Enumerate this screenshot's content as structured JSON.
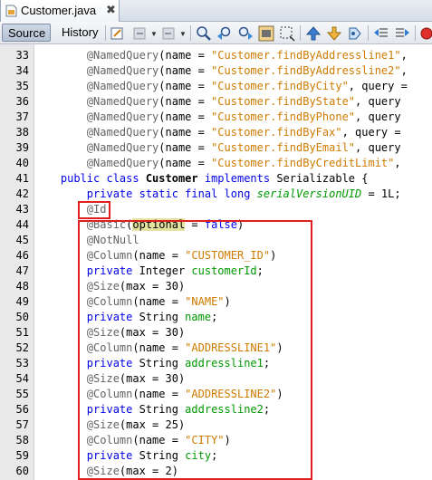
{
  "editor_tab": {
    "title": "Customer.java",
    "close": "✖"
  },
  "toolbar": {
    "source_label": "Source",
    "history_label": "History",
    "icons": [
      "last-edit-icon",
      "back-icon",
      "forward-icon",
      "find-selection-icon",
      "find-previous-icon",
      "find-next-icon",
      "toggle-highlight-icon",
      "toggle-rectangular-selection-icon",
      "previous-bookmark-icon",
      "next-bookmark-icon",
      "toggle-bookmark-icon",
      "shift-left-icon",
      "shift-right-icon",
      "start-macro-icon"
    ]
  },
  "colors": {
    "annotation": "#646464",
    "string": "#ce7b00",
    "keyword": "#0000e6",
    "field": "#009900",
    "highlight_box": "#e0201e"
  },
  "code": {
    "lines": [
      {
        "num": "33",
        "tokens": [
          [
            "ann",
            "        @NamedQuery"
          ],
          [
            "",
            "(name = "
          ],
          [
            "str",
            "\"Customer.findByAddressline1\""
          ],
          [
            "",
            ","
          ]
        ]
      },
      {
        "num": "34",
        "tokens": [
          [
            "ann",
            "        @NamedQuery"
          ],
          [
            "",
            "(name = "
          ],
          [
            "str",
            "\"Customer.findByAddressline2\""
          ],
          [
            "",
            ","
          ]
        ]
      },
      {
        "num": "35",
        "tokens": [
          [
            "ann",
            "        @NamedQuery"
          ],
          [
            "",
            "(name = "
          ],
          [
            "str",
            "\"Customer.findByCity\""
          ],
          [
            "",
            ", query ="
          ]
        ]
      },
      {
        "num": "36",
        "tokens": [
          [
            "ann",
            "        @NamedQuery"
          ],
          [
            "",
            "(name = "
          ],
          [
            "str",
            "\"Customer.findByState\""
          ],
          [
            "",
            ", query"
          ]
        ]
      },
      {
        "num": "37",
        "tokens": [
          [
            "ann",
            "        @NamedQuery"
          ],
          [
            "",
            "(name = "
          ],
          [
            "str",
            "\"Customer.findByPhone\""
          ],
          [
            "",
            ", query"
          ]
        ]
      },
      {
        "num": "38",
        "tokens": [
          [
            "ann",
            "        @NamedQuery"
          ],
          [
            "",
            "(name = "
          ],
          [
            "str",
            "\"Customer.findByFax\""
          ],
          [
            "",
            ", query ="
          ]
        ]
      },
      {
        "num": "39",
        "tokens": [
          [
            "ann",
            "        @NamedQuery"
          ],
          [
            "",
            "(name = "
          ],
          [
            "str",
            "\"Customer.findByEmail\""
          ],
          [
            "",
            ", query"
          ]
        ]
      },
      {
        "num": "40",
        "tokens": [
          [
            "ann",
            "        @NamedQuery"
          ],
          [
            "",
            "(name = "
          ],
          [
            "str",
            "\"Customer.findByCreditLimit\""
          ],
          [
            "",
            ","
          ]
        ]
      },
      {
        "num": "41",
        "tokens": [
          [
            "kw",
            "    public class "
          ],
          [
            "cls",
            "Customer"
          ],
          [
            "kw",
            " implements "
          ],
          [
            "",
            "Serializable {"
          ]
        ]
      },
      {
        "num": "42",
        "tokens": [
          [
            "kw",
            "        private static final long "
          ],
          [
            "sfld",
            "serialVersionUID"
          ],
          [
            "",
            " = 1L;"
          ]
        ]
      },
      {
        "num": "43",
        "tokens": [
          [
            "ann",
            "        @Id"
          ]
        ]
      },
      {
        "num": "44",
        "tokens": [
          [
            "ann",
            "        @Basic"
          ],
          [
            "",
            "("
          ],
          [
            "hl",
            "optional"
          ],
          [
            "",
            " = "
          ],
          [
            "kw",
            "false"
          ],
          [
            "",
            ")"
          ]
        ]
      },
      {
        "num": "45",
        "tokens": [
          [
            "ann",
            "        @NotNull"
          ]
        ]
      },
      {
        "num": "46",
        "tokens": [
          [
            "ann",
            "        @Column"
          ],
          [
            "",
            "(name = "
          ],
          [
            "str",
            "\"CUSTOMER_ID\""
          ],
          [
            "",
            ")"
          ]
        ]
      },
      {
        "num": "47",
        "tokens": [
          [
            "kw",
            "        private "
          ],
          [
            "",
            "Integer "
          ],
          [
            "fld",
            "customerId"
          ],
          [
            "",
            ";"
          ]
        ]
      },
      {
        "num": "48",
        "tokens": [
          [
            "ann",
            "        @Size"
          ],
          [
            "",
            "(max = 30)"
          ]
        ]
      },
      {
        "num": "49",
        "tokens": [
          [
            "ann",
            "        @Column"
          ],
          [
            "",
            "(name = "
          ],
          [
            "str",
            "\"NAME\""
          ],
          [
            "",
            ")"
          ]
        ]
      },
      {
        "num": "50",
        "tokens": [
          [
            "kw",
            "        private "
          ],
          [
            "",
            "String "
          ],
          [
            "fld",
            "name"
          ],
          [
            "",
            ";"
          ]
        ]
      },
      {
        "num": "51",
        "tokens": [
          [
            "ann",
            "        @Size"
          ],
          [
            "",
            "(max = 30)"
          ]
        ]
      },
      {
        "num": "52",
        "tokens": [
          [
            "ann",
            "        @Column"
          ],
          [
            "",
            "(name = "
          ],
          [
            "str",
            "\"ADDRESSLINE1\""
          ],
          [
            "",
            ")"
          ]
        ]
      },
      {
        "num": "53",
        "tokens": [
          [
            "kw",
            "        private "
          ],
          [
            "",
            "String "
          ],
          [
            "fld",
            "addressline1"
          ],
          [
            "",
            ";"
          ]
        ]
      },
      {
        "num": "54",
        "tokens": [
          [
            "ann",
            "        @Size"
          ],
          [
            "",
            "(max = 30)"
          ]
        ]
      },
      {
        "num": "55",
        "tokens": [
          [
            "ann",
            "        @Column"
          ],
          [
            "",
            "(name = "
          ],
          [
            "str",
            "\"ADDRESSLINE2\""
          ],
          [
            "",
            ")"
          ]
        ]
      },
      {
        "num": "56",
        "tokens": [
          [
            "kw",
            "        private "
          ],
          [
            "",
            "String "
          ],
          [
            "fld",
            "addressline2"
          ],
          [
            "",
            ";"
          ]
        ]
      },
      {
        "num": "57",
        "tokens": [
          [
            "ann",
            "        @Size"
          ],
          [
            "",
            "(max = 25)"
          ]
        ]
      },
      {
        "num": "58",
        "tokens": [
          [
            "ann",
            "        @Column"
          ],
          [
            "",
            "(name = "
          ],
          [
            "str",
            "\"CITY\""
          ],
          [
            "",
            ")"
          ]
        ]
      },
      {
        "num": "59",
        "tokens": [
          [
            "kw",
            "        private "
          ],
          [
            "",
            "String "
          ],
          [
            "fld",
            "city"
          ],
          [
            "",
            ";"
          ]
        ]
      },
      {
        "num": "60",
        "tokens": [
          [
            "ann",
            "        @Size"
          ],
          [
            "",
            "(max = 2)"
          ]
        ]
      }
    ]
  }
}
